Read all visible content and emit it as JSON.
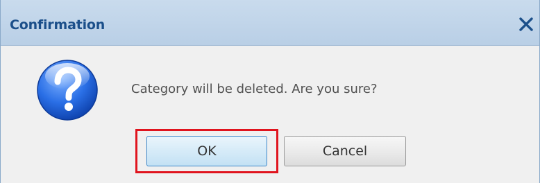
{
  "dialog": {
    "title": "Confirmation",
    "close_icon": "close-icon",
    "message": "Category will be deleted. Are you sure?",
    "icon": "question-icon",
    "ok_label": "OK",
    "cancel_label": "Cancel",
    "highlight_color": "#e0141e",
    "title_color": "#1b4f8a"
  }
}
